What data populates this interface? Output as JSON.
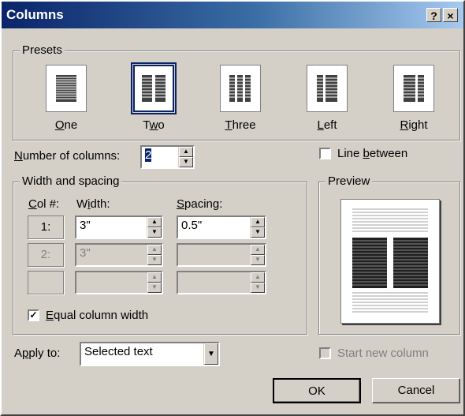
{
  "window": {
    "title": "Columns",
    "help_label": "?",
    "close_label": "×"
  },
  "presets": {
    "label": "Presets",
    "items": [
      {
        "label": "One",
        "accel": "O",
        "rest": "ne",
        "selected": false
      },
      {
        "label": "Two",
        "accel": "w",
        "pre": "T",
        "rest": "o",
        "selected": true
      },
      {
        "label": "Three",
        "accel": "T",
        "rest": "hree",
        "selected": false
      },
      {
        "label": "Left",
        "accel": "L",
        "rest": "eft",
        "selected": false
      },
      {
        "label": "Right",
        "accel": "R",
        "rest": "ight",
        "selected": false
      }
    ]
  },
  "num_columns": {
    "label_accel": "N",
    "label_rest": "umber of columns:",
    "value": "2"
  },
  "line_between": {
    "label_pre": "Line ",
    "label_accel": "b",
    "label_rest": "etween",
    "checked": false
  },
  "width_spacing": {
    "label": "Width and spacing",
    "col_header_accel": "C",
    "col_header_rest": "ol #:",
    "width_header_pre": "W",
    "width_header_accel": "i",
    "width_header_rest": "dth:",
    "spacing_header_accel": "S",
    "spacing_header_rest": "pacing:",
    "rows": [
      {
        "col": "1:",
        "width": "3\"",
        "spacing": "0.5\"",
        "enabled": true
      },
      {
        "col": "2:",
        "width": "3\"",
        "spacing": "",
        "enabled": false
      },
      {
        "col": "",
        "width": "",
        "spacing": "",
        "enabled": false
      }
    ]
  },
  "equal_width": {
    "label_accel": "E",
    "label_rest": "qual column width",
    "checked": true
  },
  "preview": {
    "label": "Preview"
  },
  "apply_to": {
    "label_pre": "A",
    "label_accel": "p",
    "label_rest": "ply to:",
    "value": "Selected text"
  },
  "start_new_column": {
    "label": "Start new column",
    "checked": false
  },
  "buttons": {
    "ok": "OK",
    "cancel": "Cancel"
  }
}
